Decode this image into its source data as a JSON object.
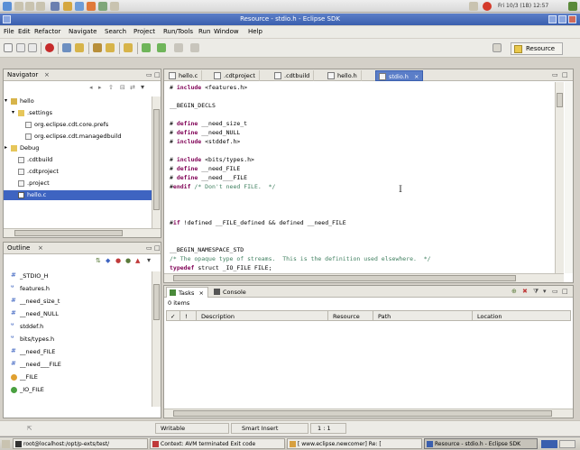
{
  "window": {
    "title": "Resource - stdio.h - Eclipse SDK"
  },
  "os_panel": {
    "clock": "Fri 10/3 (1B) 12:57"
  },
  "colors": {
    "accent": "#3a5fae",
    "selection": "#3e64c1",
    "keyword": "#7f0055",
    "comment": "#3f7f5f"
  },
  "menu": [
    "File",
    "Edit",
    "Refactor",
    "Navigate",
    "Search",
    "Project",
    "Run/Tools",
    "Run",
    "Window",
    "Help"
  ],
  "perspective": {
    "label": "Resource"
  },
  "navigator": {
    "title": "Navigator",
    "items": [
      {
        "label": "hello",
        "icon": "project-folder-icon"
      },
      {
        "label": ".settings",
        "icon": "folder-icon"
      },
      {
        "label": "org.eclipse.cdt.core.prefs",
        "icon": "file-icon"
      },
      {
        "label": "org.eclipse.cdt.managedbuild",
        "icon": "file-icon"
      },
      {
        "label": "Debug",
        "icon": "folder-icon"
      },
      {
        "label": ".cdtbuild",
        "icon": "file-icon"
      },
      {
        "label": ".cdtproject",
        "icon": "file-icon"
      },
      {
        "label": ".project",
        "icon": "file-icon"
      },
      {
        "label": "hello.c",
        "icon": "c-file-icon"
      }
    ]
  },
  "outline": {
    "title": "Outline",
    "items": [
      {
        "label": "_STDIO_H",
        "icon": "define-icon"
      },
      {
        "label": "features.h",
        "icon": "include-icon"
      },
      {
        "label": "__need_size_t",
        "icon": "define-icon"
      },
      {
        "label": "__need_NULL",
        "icon": "define-icon"
      },
      {
        "label": "stddef.h",
        "icon": "include-icon"
      },
      {
        "label": "bits/types.h",
        "icon": "include-icon"
      },
      {
        "label": "__need_FILE",
        "icon": "define-icon"
      },
      {
        "label": "__need___FILE",
        "icon": "define-icon"
      },
      {
        "label": "__FILE",
        "icon": "struct-icon"
      },
      {
        "label": "_IO_FILE",
        "icon": "struct-icon"
      }
    ]
  },
  "editor": {
    "tabs": [
      "hello.c",
      ".cdtproject",
      ".cdtbuild",
      "hello.h",
      "stdio.h"
    ],
    "active_tab": "stdio.h",
    "lines": [
      {
        "pre": "# ",
        "kw": "include",
        "rest": " <features.h>",
        "cm": ""
      },
      {
        "pre": "",
        "kw": "",
        "rest": "",
        "cm": ""
      },
      {
        "pre": "",
        "kw": "",
        "rest": "__BEGIN_DECLS",
        "cm": ""
      },
      {
        "pre": "",
        "kw": "",
        "rest": "",
        "cm": ""
      },
      {
        "pre": "# ",
        "kw": "define",
        "rest": " __need_size_t",
        "cm": ""
      },
      {
        "pre": "# ",
        "kw": "define",
        "rest": " __need_NULL",
        "cm": ""
      },
      {
        "pre": "# ",
        "kw": "include",
        "rest": " <stddef.h>",
        "cm": ""
      },
      {
        "pre": "",
        "kw": "",
        "rest": "",
        "cm": ""
      },
      {
        "pre": "# ",
        "kw": "include",
        "rest": " <bits/types.h>",
        "cm": ""
      },
      {
        "pre": "# ",
        "kw": "define",
        "rest": " __need_FILE",
        "cm": ""
      },
      {
        "pre": "# ",
        "kw": "define",
        "rest": " __need___FILE",
        "cm": ""
      },
      {
        "pre": "#",
        "kw": "endif",
        "rest": " ",
        "cm": "/* Don't need FILE.  */"
      },
      {
        "pre": "",
        "kw": "",
        "rest": "",
        "cm": ""
      },
      {
        "pre": "",
        "kw": "",
        "rest": "",
        "cm": ""
      },
      {
        "pre": "",
        "kw": "",
        "rest": "",
        "cm": ""
      },
      {
        "pre": "#",
        "kw": "if",
        "rest": " !defined __FILE_defined && defined __need_FILE",
        "cm": ""
      },
      {
        "pre": "",
        "kw": "",
        "rest": "",
        "cm": ""
      },
      {
        "pre": "",
        "kw": "",
        "rest": "",
        "cm": ""
      },
      {
        "pre": "",
        "kw": "",
        "rest": "__BEGIN_NAMESPACE_STD",
        "cm": ""
      },
      {
        "pre": "",
        "kw": "",
        "rest": "",
        "cm": "/* The opaque type of streams.  This is the definition used elsewhere.  */"
      },
      {
        "pre": "",
        "kw": "typedef",
        "rest": " struct _IO_FILE FILE;",
        "cm": ""
      }
    ]
  },
  "tasks": {
    "tabs": [
      "Tasks",
      "Console"
    ],
    "count": "0 items",
    "columns": [
      "!",
      "Description",
      "Resource",
      "Path",
      "Location"
    ]
  },
  "status": {
    "writable": "Writable",
    "insert_mode": "Smart Insert",
    "position": "1 : 1"
  },
  "taskbar": {
    "items": [
      "root@localhost:/opt/p-exts/test/",
      "Context: AVM terminated Exit code",
      "[ www.eclipse.newcomer] Re: [",
      "Resource - stdio.h - Eclipse SDK"
    ]
  }
}
